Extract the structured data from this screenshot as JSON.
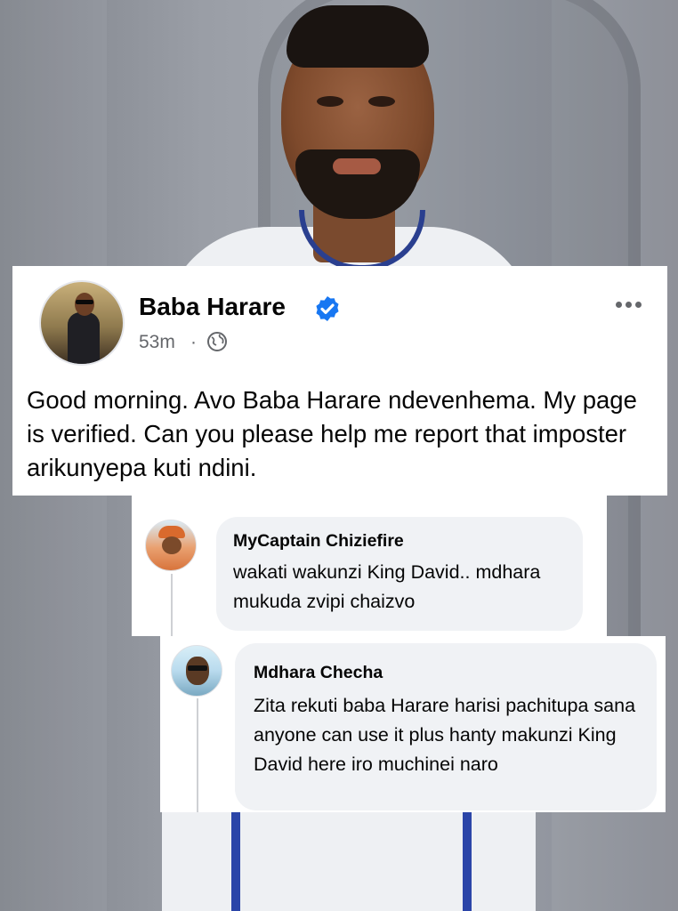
{
  "post": {
    "author_name": "Baba Harare",
    "timestamp": "53m",
    "separator": "·",
    "privacy_icon": "globe-icon",
    "verified_icon": "verified-badge-icon",
    "more_icon": "more-options-icon",
    "text": "Good morning. Avo Baba Harare ndevenhema. My page is verified. Can you please help me report that imposter arikunyepa kuti ndini.",
    "colors": {
      "verified_blue": "#1877f2",
      "secondary_text": "#65676b",
      "bubble_bg": "#f0f2f5"
    }
  },
  "comments": [
    {
      "author_name": "MyCaptain Chiziefire",
      "text": "wakati wakunzi King David.. mdhara mukuda zvipi chaizvo"
    },
    {
      "author_name": "Mdhara Checha",
      "text": "Zita rekuti baba Harare harisi pachitupa sana anyone can use it plus hanty makunzi King David here iro muchinei naro"
    }
  ]
}
